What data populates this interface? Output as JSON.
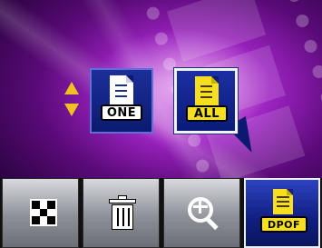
{
  "menu": {
    "options": [
      {
        "id": "one",
        "label": "ONE",
        "selected": false
      },
      {
        "id": "all",
        "label": "ALL",
        "selected": true
      }
    ]
  },
  "toolbar": {
    "dpof_label": "DPOF",
    "buttons": [
      {
        "id": "mosaic",
        "icon": "checkerboard-icon"
      },
      {
        "id": "delete",
        "icon": "trash-icon"
      },
      {
        "id": "zoom",
        "icon": "zoom-in-icon"
      },
      {
        "id": "dpof",
        "icon": "dpof-print-icon",
        "active": true
      }
    ]
  },
  "colors": {
    "accent_yellow": "#f5df20",
    "button_blue": "#0b1a70",
    "background_magenta": "#9a22bf"
  }
}
